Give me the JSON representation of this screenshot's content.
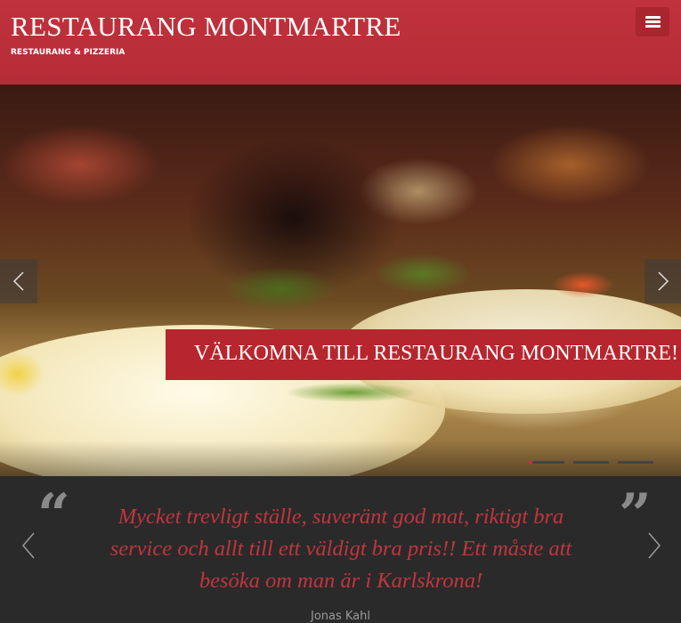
{
  "header": {
    "title": "RESTAURANG MONTMARTRE",
    "subtitle": "RESTAURANG & PIZZERIA",
    "menu_icon": "hamburger-menu-icon",
    "accent_color": "#b62c37"
  },
  "slider": {
    "caption": "VÄLKOMNA TILL RESTAURANG MONTMARTRE!",
    "prev_icon": "chevron-left-icon",
    "next_icon": "chevron-right-icon",
    "slide_count": 3,
    "active_slide": 1
  },
  "testimonial": {
    "open_quote": "“",
    "close_quote": "”",
    "text": "Mycket trevligt ställe, suveränt god mat, riktigt bra service och allt till ett väldigt bra pris!! Ett måste att besöka om man är i Karlskrona!",
    "author": "Jonas Kahl",
    "text_color": "#c4343d"
  }
}
